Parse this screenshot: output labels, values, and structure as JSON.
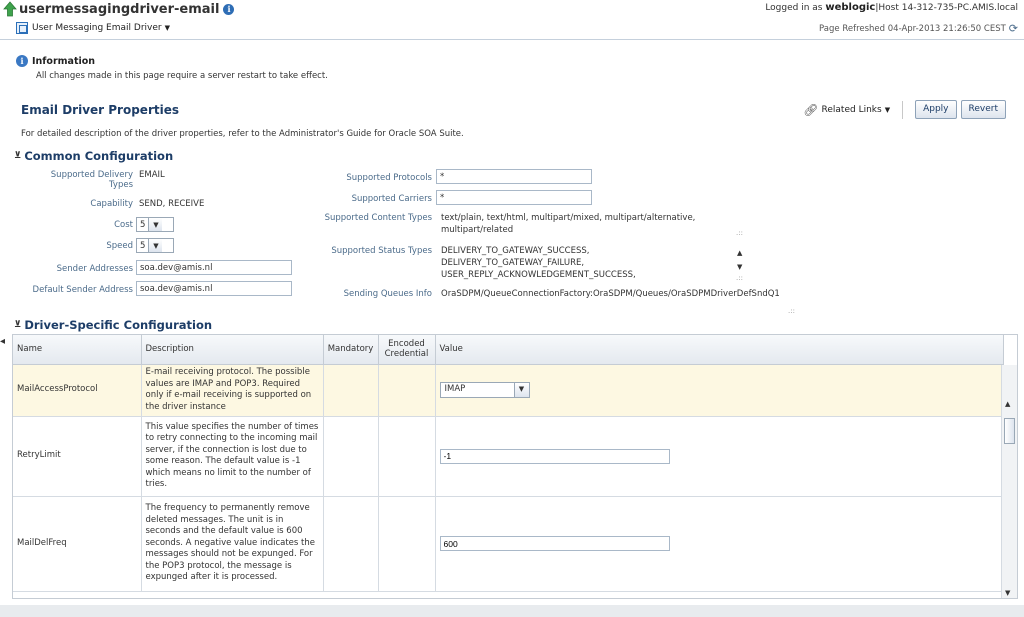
{
  "header": {
    "title": "usermessagingdriver-email",
    "target_menu": "User Messaging Email Driver",
    "logged_in_prefix": "Logged in as",
    "user": "weblogic",
    "host": "|Host 14-312-735-PC.AMIS.local",
    "refreshed": "Page Refreshed 04-Apr-2013 21:26:50 CEST"
  },
  "info": {
    "title": "Information",
    "message": "All changes made in this page require a server restart to take effect."
  },
  "section": {
    "title": "Email Driver Properties",
    "related_links": "Related Links",
    "apply": "Apply",
    "revert": "Revert",
    "description": "For detailed description of the driver properties, refer to the Administrator's Guide for Oracle SOA Suite."
  },
  "common": {
    "title": "Common Configuration",
    "delivery_types_label": "Supported Delivery Types",
    "delivery_types": "EMAIL",
    "capability_label": "Capability",
    "capability": "SEND, RECEIVE",
    "cost_label": "Cost",
    "cost": "5",
    "speed_label": "Speed",
    "speed": "5",
    "sender_addresses_label": "Sender Addresses",
    "sender_addresses": "soa.dev@amis.nl",
    "default_sender_label": "Default Sender Address",
    "default_sender": "soa.dev@amis.nl",
    "protocols_label": "Supported Protocols",
    "protocols": "*",
    "carriers_label": "Supported Carriers",
    "carriers": "*",
    "content_types_label": "Supported Content Types",
    "content_types_line1": "text/plain, text/html, multipart/mixed, multipart/alternative,",
    "content_types_line2": "multipart/related",
    "status_types_label": "Supported Status Types",
    "status_types_line1": "DELIVERY_TO_GATEWAY_SUCCESS,",
    "status_types_line2": "DELIVERY_TO_GATEWAY_FAILURE,",
    "status_types_line3": "USER_REPLY_ACKNOWLEDGEMENT_SUCCESS,",
    "queues_label": "Sending Queues Info",
    "queues": "OraSDPM/QueueConnectionFactory:OraSDPM/Queues/OraSDPMDriverDefSndQ1"
  },
  "driver": {
    "title": "Driver-Specific Configuration",
    "columns": {
      "name": "Name",
      "description": "Description",
      "mandatory": "Mandatory",
      "encoded": "Encoded Credential",
      "value": "Value"
    },
    "rows": [
      {
        "name": "MailAccessProtocol",
        "description": "E-mail receiving protocol. The possible values are IMAP and POP3. Required only if e-mail receiving is supported on the driver instance",
        "value": "IMAP"
      },
      {
        "name": "RetryLimit",
        "description": "This value specifies the number of times to retry connecting to the incoming mail server, if the connection is lost due to some reason. The default value is -1 which means no limit to the number of tries.",
        "value": "-1"
      },
      {
        "name": "MailDelFreq",
        "description": "The frequency to permanently remove deleted messages. The unit is in seconds and the default value is 600 seconds. A negative value indicates the messages should not be expunged. For the POP3 protocol, the message is expunged after it is processed.",
        "value": "600"
      }
    ]
  }
}
